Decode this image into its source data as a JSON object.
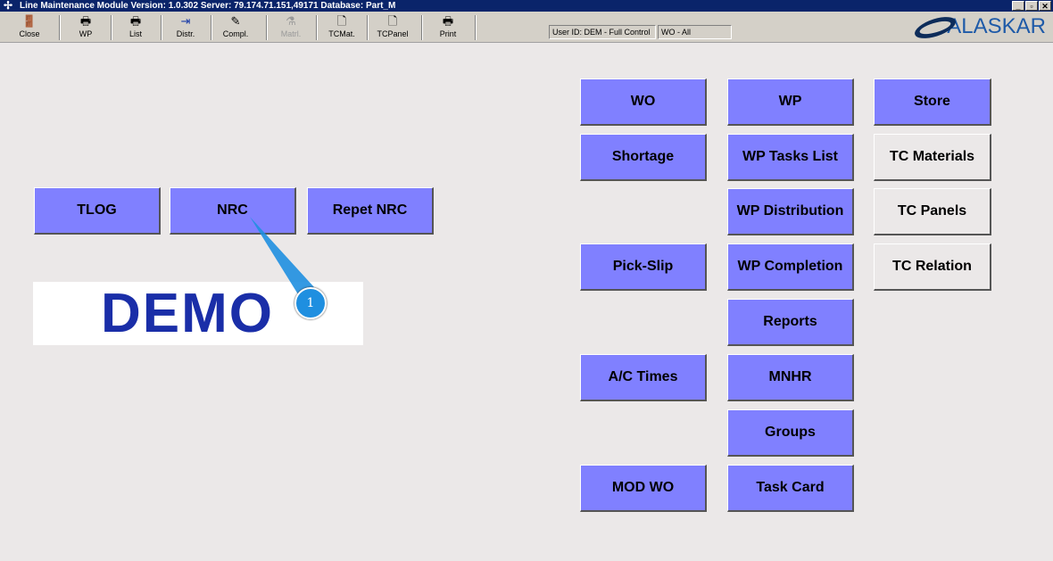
{
  "window": {
    "title": "Line Maintenance Module  Version: 1.0.302 Server: 79.174.71.151,49171 Database: Part_M",
    "minimize": "_",
    "restore": "▫",
    "close": "✕"
  },
  "toolbar": [
    {
      "label": "Close",
      "icon": "door-exit-icon"
    },
    {
      "label": "WP",
      "icon": "printer-icon"
    },
    {
      "label": "List",
      "icon": "printer-icon"
    },
    {
      "label": "Distr.",
      "icon": "distribute-icon"
    },
    {
      "label": "Compl.",
      "icon": "complete-icon"
    },
    {
      "label": "Matrl.",
      "icon": "flask-icon",
      "disabled": true
    },
    {
      "label": "TCMat.",
      "icon": "document-icon"
    },
    {
      "label": "TCPanel",
      "icon": "document-icon"
    },
    {
      "label": "Print",
      "icon": "printer-icon"
    }
  ],
  "status": {
    "user": "User ID: DEM - Full Control",
    "wo": "WO - All"
  },
  "logo": "ALASKAR",
  "left_buttons": [
    "TLOG",
    "NRC",
    "Repet NRC"
  ],
  "demo": "DEMO",
  "marker": "1",
  "col1": {
    "wo": "WO",
    "shortage": "Shortage",
    "pickslip": "Pick-Slip",
    "actimes": "A/C Times",
    "modwo": "MOD WO"
  },
  "col2": [
    "WP",
    "WP Tasks List",
    "WP Distribution",
    "WP Completion",
    "Reports",
    "MNHR",
    "Groups",
    "Task Card"
  ],
  "col3": [
    "Store",
    "TC Materials",
    "TC Panels",
    "TC Relation"
  ]
}
